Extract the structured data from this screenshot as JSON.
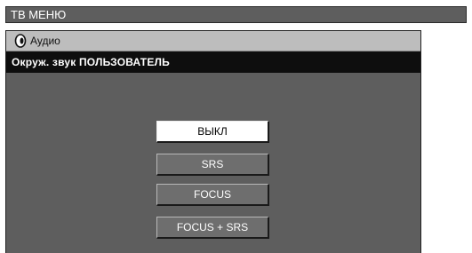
{
  "menu": {
    "title": "ТВ МЕНЮ"
  },
  "audio": {
    "label": "Аудио",
    "icon": "audio-disc-icon"
  },
  "setting": {
    "label": "Окруж. звук  ПОЛЬЗОВАТЕЛЬ"
  },
  "options": [
    {
      "label": "ВЫКЛ",
      "selected": true
    },
    {
      "label": "SRS",
      "selected": false
    },
    {
      "label": "FOCUS",
      "selected": false
    },
    {
      "label": "FOCUS + SRS",
      "selected": false
    }
  ],
  "colors": {
    "panel": "#5e5e5e",
    "header": "#bdbdbd",
    "setting_bar": "#0e0e0e",
    "selected": "#ffffff"
  }
}
